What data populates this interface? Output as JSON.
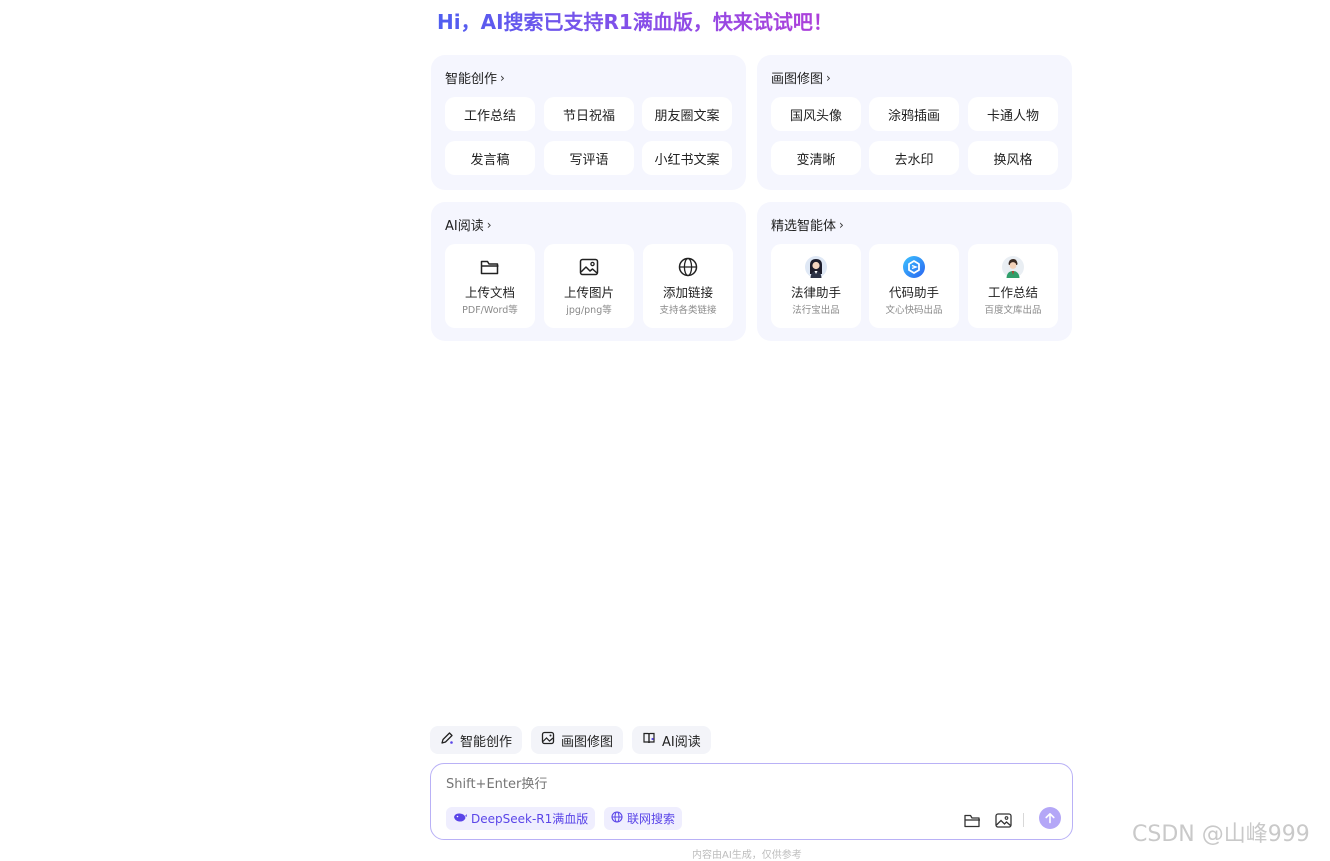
{
  "headline": "Hi，AI搜索已支持R1满血版，快来试试吧！",
  "cards": {
    "creation": {
      "title": "智能创作",
      "chips": [
        "工作总结",
        "节日祝福",
        "朋友圈文案",
        "发言稿",
        "写评语",
        "小红书文案"
      ]
    },
    "image": {
      "title": "画图修图",
      "chips": [
        "国风头像",
        "涂鸦插画",
        "卡通人物",
        "变清晰",
        "去水印",
        "换风格"
      ]
    },
    "reading": {
      "title": "AI阅读",
      "tiles": [
        {
          "title": "上传文档",
          "sub": "PDF/Word等",
          "icon": "folder-icon"
        },
        {
          "title": "上传图片",
          "sub": "jpg/png等",
          "icon": "image-icon"
        },
        {
          "title": "添加链接",
          "sub": "支持各类链接",
          "icon": "globe-icon"
        }
      ]
    },
    "agents": {
      "title": "精选智能体",
      "tiles": [
        {
          "title": "法律助手",
          "sub": "法行宝出品",
          "icon": "lawyer-avatar"
        },
        {
          "title": "代码助手",
          "sub": "文心快码出品",
          "icon": "code-logo"
        },
        {
          "title": "工作总结",
          "sub": "百度文库出品",
          "icon": "worker-avatar"
        }
      ]
    }
  },
  "quick_actions": [
    "智能创作",
    "画图修图",
    "AI阅读"
  ],
  "input": {
    "placeholder": "Shift+Enter换行",
    "model_pill": "DeepSeek-R1满血版",
    "web_search_pill": "联网搜索"
  },
  "disclaimer": "内容由AI生成，仅供参考",
  "watermark": "CSDN @山峰999",
  "colors": {
    "accent": "#5a45e8",
    "card_bg": "#f5f6fe",
    "send_button": "#b4a7f7",
    "input_border": "#b9b1f6"
  }
}
